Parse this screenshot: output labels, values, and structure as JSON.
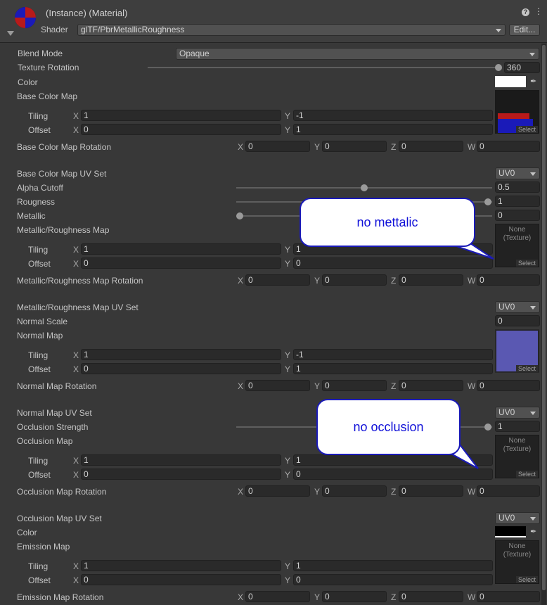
{
  "header": {
    "title": "(Instance) (Material)",
    "shader_label": "Shader",
    "shader_value": "glTF/PbrMetallicRoughness",
    "edit_button": "Edit..."
  },
  "axes": {
    "x": "X",
    "y": "Y",
    "z": "Z",
    "w": "W"
  },
  "props": {
    "blend_mode": {
      "label": "Blend Mode",
      "value": "Opaque"
    },
    "texture_rotation": {
      "label": "Texture Rotation",
      "value": "360"
    },
    "color": {
      "label": "Color",
      "swatch": "#ffffff"
    },
    "base_color_map": {
      "label": "Base Color Map",
      "tiling_label": "Tiling",
      "offset_label": "Offset",
      "tiling_x": "1",
      "tiling_y": "-1",
      "offset_x": "0",
      "offset_y": "1",
      "select": "Select"
    },
    "base_color_map_rotation": {
      "label": "Base Color Map Rotation",
      "x": "0",
      "y": "0",
      "z": "0",
      "w": "0"
    },
    "base_color_map_uv_set": {
      "label": "Base Color Map UV Set",
      "value": "UV0"
    },
    "alpha_cutoff": {
      "label": "Alpha Cutoff",
      "value": "0.5"
    },
    "rougness": {
      "label": "Rougness",
      "value": "1"
    },
    "metallic": {
      "label": "Metallic",
      "value": "0"
    },
    "metallic_roughness_map": {
      "label": "Metallic/Roughness Map",
      "tiling_label": "Tiling",
      "offset_label": "Offset",
      "tiling_x": "1",
      "tiling_y": "1",
      "offset_x": "0",
      "offset_y": "0",
      "none": "None\n(Texture)",
      "select": "Select"
    },
    "metallic_roughness_map_rotation": {
      "label": "Metallic/Roughness Map Rotation",
      "x": "0",
      "y": "0",
      "z": "0",
      "w": "0"
    },
    "metallic_roughness_map_uv_set": {
      "label": "Metallic/Roughness Map UV Set",
      "value": "UV0"
    },
    "normal_scale": {
      "label": "Normal Scale",
      "value": "0"
    },
    "normal_map": {
      "label": "Normal Map",
      "tiling_label": "Tiling",
      "offset_label": "Offset",
      "tiling_x": "1",
      "tiling_y": "-1",
      "offset_x": "0",
      "offset_y": "1",
      "select": "Select",
      "swatch": "#5a58b2"
    },
    "normal_map_rotation": {
      "label": "Normal Map Rotation",
      "x": "0",
      "y": "0",
      "z": "0",
      "w": "0"
    },
    "normal_map_uv_set": {
      "label": "Normal Map UV Set",
      "value": "UV0"
    },
    "occlusion_strength": {
      "label": "Occlusion Strength",
      "value": "1"
    },
    "occlusion_map": {
      "label": "Occlusion Map",
      "tiling_label": "Tiling",
      "offset_label": "Offset",
      "tiling_x": "1",
      "tiling_y": "1",
      "offset_x": "0",
      "offset_y": "0",
      "none": "None\n(Texture)",
      "select": "Select"
    },
    "occlusion_map_rotation": {
      "label": "Occlusion Map Rotation",
      "x": "0",
      "y": "0",
      "z": "0",
      "w": "0"
    },
    "occlusion_map_uv_set": {
      "label": "Occlusion Map UV Set",
      "value": "UV0"
    },
    "emission_color": {
      "label": "Color",
      "swatch": "#000000"
    },
    "emission_map": {
      "label": "Emission Map",
      "tiling_label": "Tiling",
      "offset_label": "Offset",
      "tiling_x": "1",
      "tiling_y": "1",
      "offset_x": "0",
      "offset_y": "0",
      "none": "None\n(Texture)",
      "select": "Select"
    },
    "emission_map_rotation": {
      "label": "Emission Map Rotation",
      "x": "0",
      "y": "0",
      "z": "0",
      "w": "0"
    }
  },
  "annotations": {
    "no_metallic": "no mettalic",
    "no_occlusion": "no occlusion"
  }
}
